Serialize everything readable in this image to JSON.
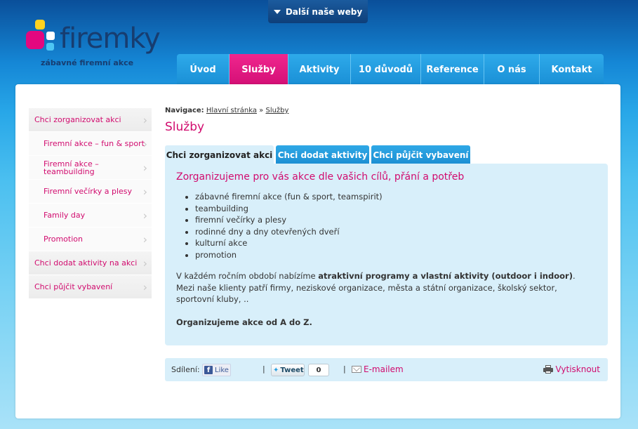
{
  "top_bar": {
    "dropdown_label": "Další naše weby"
  },
  "logo": {
    "wordmark": "firemky",
    "tagline": "zábavné firemní akce"
  },
  "nav": {
    "items": [
      {
        "label": "Úvod",
        "active": false
      },
      {
        "label": "Služby",
        "active": true
      },
      {
        "label": "Aktivity",
        "active": false
      },
      {
        "label": "10 důvodů",
        "active": false
      },
      {
        "label": "Reference",
        "active": false
      },
      {
        "label": "O nás",
        "active": false
      },
      {
        "label": "Kontakt",
        "active": false
      }
    ]
  },
  "sidebar": {
    "items": [
      {
        "label": "Chci zorganizovat akci",
        "level": 1
      },
      {
        "label": "Firemní akce – fun & sport",
        "level": 2
      },
      {
        "label": "Firemní akce – teambuilding",
        "level": 2
      },
      {
        "label": "Firemní večírky a plesy",
        "level": 2
      },
      {
        "label": "Family day",
        "level": 2
      },
      {
        "label": "Promotion",
        "level": 2
      },
      {
        "label": "Chci dodat aktivity na akci",
        "level": 1
      },
      {
        "label": "Chci půjčit vybavení",
        "level": 1
      }
    ]
  },
  "breadcrumb": {
    "prefix": "Navigace:",
    "home": "Hlavní stránka",
    "separator": "»",
    "current": "Služby"
  },
  "page_title": "Služby",
  "tabs": [
    {
      "label": "Chci zorganizovat akci",
      "active": true
    },
    {
      "label": "Chci dodat aktivity",
      "active": false
    },
    {
      "label": "Chci půjčit vybavení",
      "active": false
    }
  ],
  "panel": {
    "heading": "Zorganizujeme pro vás akce dle vašich cílů, přání a potřeb",
    "bullets": [
      "zábavné firemní akce (fun & sport, teamspirit)",
      "teambuilding",
      "firemní večírky a plesy",
      "rodinné dny a dny otevřených dveří",
      "kulturní akce",
      "promotion"
    ],
    "para1_start": "V každém ročním období nabízíme ",
    "para1_bold": "atraktivní programy a vlastní aktivity (outdoor i indoor)",
    "para1_end": ".",
    "para2": "Mezi naše klienty patří firmy, neziskové organizace, města a státní organizace, školský sektor, sportovní kluby, ..",
    "para3": "Organizujeme akce od A do Z."
  },
  "share": {
    "label": "Sdílení:",
    "fb_like": "Like",
    "separator": "|",
    "tweet": "Tweet",
    "tweet_count": "0",
    "email": "E-mailem",
    "print": "Vytisknout"
  },
  "colors": {
    "accent_pink": "#d10b6e",
    "nav_blue": "#1a8fd6",
    "panel_blue": "#d8effa"
  }
}
